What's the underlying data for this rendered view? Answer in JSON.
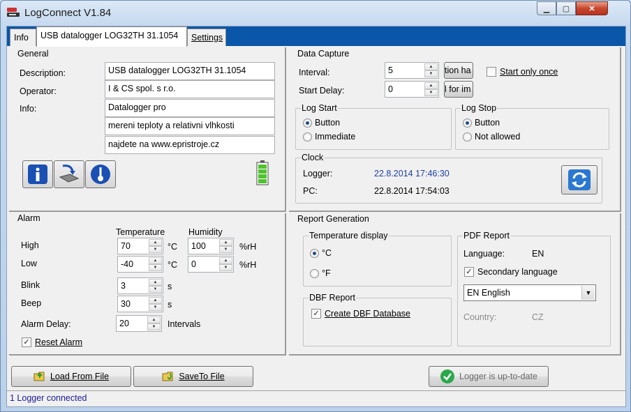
{
  "window": {
    "title": "LogConnect V1.84"
  },
  "tabs": [
    {
      "label": "Info"
    },
    {
      "label": "USB datalogger LOG32TH 31.1054"
    },
    {
      "label": "Settings"
    }
  ],
  "general": {
    "title": "General",
    "description_label": "Description:",
    "operator_label": "Operator:",
    "info_label": "Info:",
    "description_value": "USB datalogger LOG32TH 31.1054",
    "operator_value": " I & CS spol. s r.o.",
    "info_lines": [
      "Datalogger pro",
      "mereni teploty a relativni vlhkosti",
      "najdete na www.epristroje.cz"
    ]
  },
  "data_capture": {
    "title": "Data Capture",
    "interval_label": "Interval:",
    "interval_value": "5",
    "interval_unit": "tion ha",
    "start_delay_label": "Start Delay:",
    "start_delay_value": "0",
    "start_delay_unit": "l for im",
    "start_only_once": "Start only once",
    "log_start": {
      "title": "Log Start",
      "options": [
        "Button",
        "Immediate"
      ],
      "selected": "Button"
    },
    "log_stop": {
      "title": "Log Stop",
      "options": [
        "Button",
        "Not allowed"
      ],
      "selected": "Button"
    }
  },
  "clock": {
    "title": "Clock",
    "logger_label": "Logger:",
    "logger_value": "22.8.2014  17:46:30",
    "pc_label": "PC:",
    "pc_value": "22.8.2014  17:54:03"
  },
  "alarm": {
    "title": "Alarm",
    "temperature_header": "Temperature",
    "humidity_header": "Humidity",
    "high_label": "High",
    "low_label": "Low",
    "blink_label": "Blink",
    "beep_label": "Beep",
    "alarm_delay_label": "Alarm Delay:",
    "high_temp": "70",
    "low_temp": "-40",
    "high_hum": "100",
    "low_hum": "0",
    "blink": "3",
    "beep": "30",
    "alarm_delay": "20",
    "unit_c": "°C",
    "unit_rh": "%rH",
    "unit_s": "s",
    "unit_intervals": "Intervals",
    "reset_alarm": "Reset Alarm"
  },
  "report": {
    "title": "Report Generation",
    "temp_display_title": "Temperature display",
    "celsius": "°C",
    "fahrenheit": "°F",
    "dbf_title": "DBF Report",
    "create_dbf": "Create DBF Database",
    "pdf_title": "PDF Report",
    "language_label": "Language:",
    "language_value": "EN",
    "secondary_language": "Secondary language",
    "secondary_select": "EN  English",
    "country_label": "Country:",
    "country_value": "CZ"
  },
  "bottom": {
    "load_button": "Load From File",
    "save_button": "SaveTo File",
    "status_button": "Logger is up-to-date"
  },
  "statusbar": {
    "text": "1 Logger connected"
  },
  "colors": {
    "tabstrip": "#0a56a8",
    "clock_value": "#1a3fa3",
    "status_text": "#1a1a9a"
  }
}
